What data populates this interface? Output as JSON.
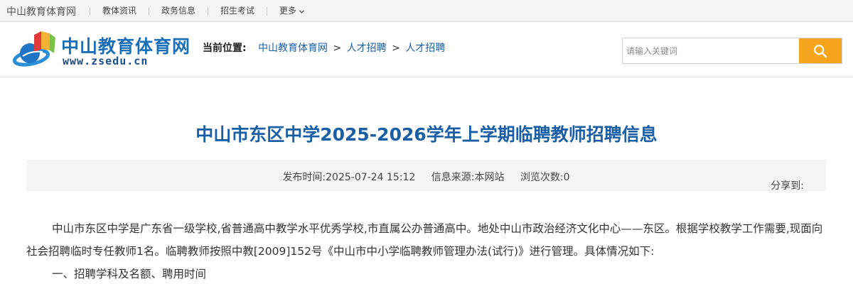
{
  "topbar": {
    "site_name": "中山教育体育网",
    "nav": [
      "教体资讯",
      "政务信息",
      "招生考试"
    ],
    "more_label": "更多"
  },
  "logo": {
    "cn": "中山教育体育网",
    "en": "www.zsedu.cn"
  },
  "breadcrumb": {
    "lead": "当前位置:",
    "items": [
      "中山教育体育网",
      "人才招聘",
      "人才招聘"
    ],
    "separator": ">"
  },
  "search": {
    "placeholder": "请输入关键词"
  },
  "article": {
    "title": "中山市东区中学2025-2026学年上学期临聘教师招聘信息",
    "publish": "发布时间:2025-07-24 15:12",
    "source": "信息来源:本网站",
    "views": "浏览次数:0",
    "share_label": "分享到:",
    "paragraph1": "中山市东区中学是广东省一级学校,省普通高中教学水平优秀学校,市直属公办普通高中。地处中山市政治经济文化中心——东区。根据学校教学工作需要,现面向社会招聘临时专任教师1名。临聘教师按照中教[2009]152号《中山市中小学临聘教师管理办法(试行)》进行管理。具体情况如下:",
    "heading1": "一、招聘学科及名额、聘用时间"
  },
  "colors": {
    "link_blue": "#1a5fa6",
    "search_button": "#f7a51c"
  }
}
